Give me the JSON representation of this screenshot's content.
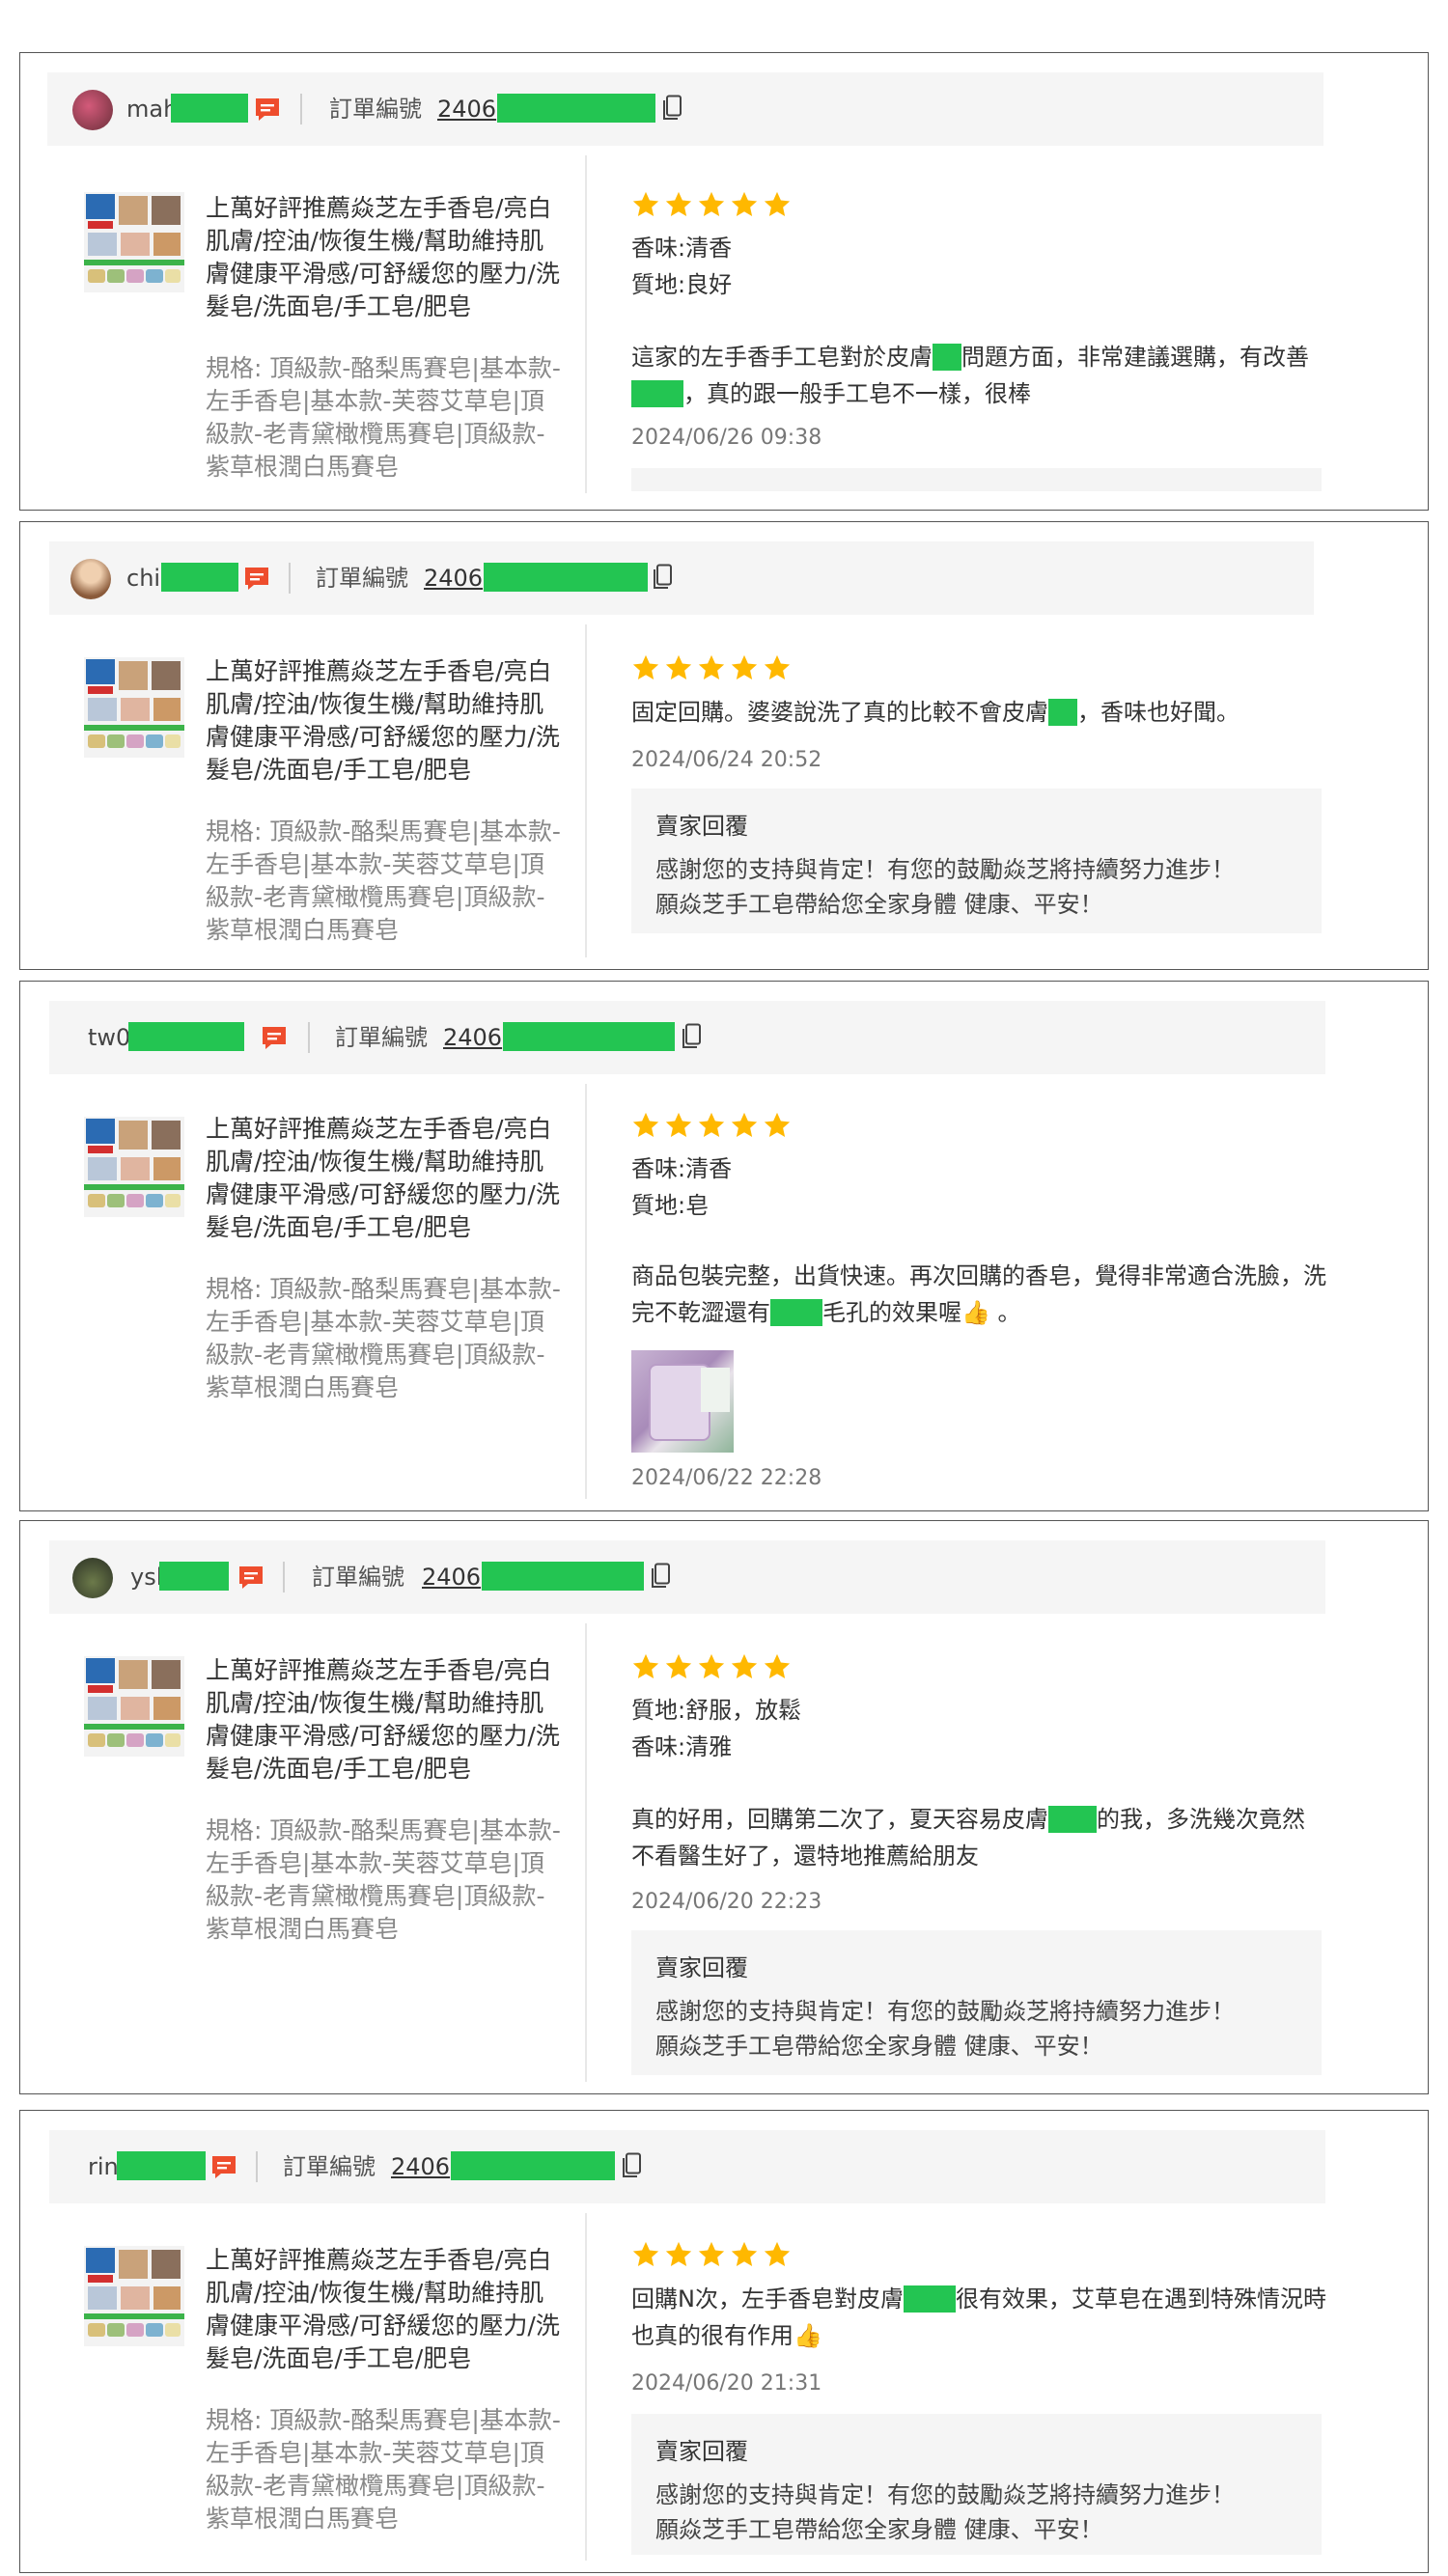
{
  "colors": {
    "mask": "#23c552",
    "star": "#ffb800",
    "chat_icon": "#ee4d2d"
  },
  "icons": {
    "chat": "chat-bubble-icon",
    "copy": "copy-icon",
    "star": "star-icon"
  },
  "product": {
    "name": "上萬好評推薦焱芝左手香皂/亮白肌膚/控油/恢復生機/幫助維持肌膚健康平滑感/可舒緩您的壓力/洗髮皂/洗面皂/手工皂/肥皂",
    "variant": "規格: 頂級款-酪梨馬賽皂|基本款-左手香皂|基本款-芙蓉艾草皂|頂級款-老青黛橄欖馬賽皂|頂級款-紫草根潤白馬賽皂"
  },
  "labels": {
    "order": "訂單編號",
    "seller_reply": "賣家回覆"
  },
  "seller_reply_text": "感謝您的支持與肯定！有您的鼓勵焱芝將持續努力進步！\n願焱芝手工皂帶給您全家身體 健康、平安！",
  "reviews": [
    {
      "user": "mah",
      "order_prefix": "2406",
      "rating": 5,
      "attrs": [
        "香味:清香",
        "質地:良好"
      ],
      "text_parts": [
        "這家的左手香手工皂對於皮膚",
        "問題方面，非常建議選購，有改善",
        "，真的跟一般手工皂不一樣，很棒"
      ],
      "date": "2024/06/26 09:38"
    },
    {
      "user": "chi",
      "order_prefix": "2406",
      "rating": 5,
      "attrs": [],
      "text_parts": [
        "固定回購。婆婆說洗了真的比較不會皮膚",
        "，香味也好聞。"
      ],
      "date": "2024/06/24 20:52"
    },
    {
      "user": "tw0",
      "order_prefix": "2406",
      "rating": 5,
      "attrs": [
        "香味:清香",
        "質地:皂"
      ],
      "text_parts": [
        "商品包裝完整，出貨快速。再次回購的香皂，覺得非常適合洗臉，洗完不乾澀還有",
        "毛孔的效果喔👍 。"
      ],
      "date": "2024/06/22 22:28"
    },
    {
      "user": "ysl",
      "order_prefix": "2406",
      "rating": 5,
      "attrs": [
        "質地:舒服，放鬆",
        "香味:清雅"
      ],
      "text_parts": [
        "真的好用，回購第二次了，夏天容易皮膚",
        "的我，多洗幾次竟然不看醫生好了，還特地推薦給朋友"
      ],
      "date": "2024/06/20 22:23"
    },
    {
      "user": "rin",
      "order_prefix": "2406",
      "rating": 5,
      "attrs": [],
      "text_parts": [
        "回購N次，左手香皂對皮膚",
        "很有效果，艾草皂在遇到特殊情況時也真的很有作用👍"
      ],
      "date": "2024/06/20 21:31"
    }
  ]
}
